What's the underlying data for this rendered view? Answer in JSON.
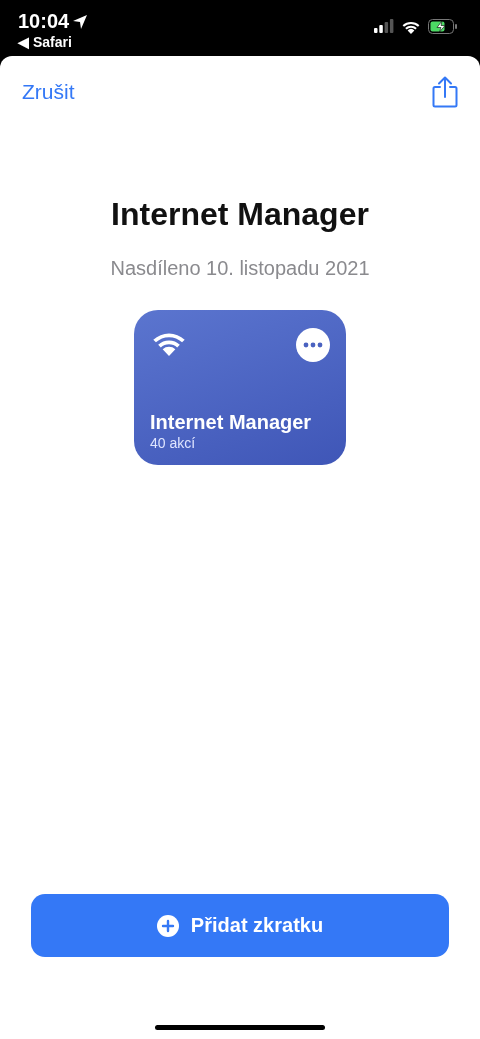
{
  "status_bar": {
    "time": "10:04",
    "back_app": "◀ Safari"
  },
  "nav": {
    "cancel": "Zrušit"
  },
  "title": "Internet Manager",
  "subtitle": "Nasdíleno 10. listopadu 2021",
  "shortcut": {
    "name": "Internet Manager",
    "actions": "40 akcí"
  },
  "add_button": {
    "label": "Přidat zkratku"
  }
}
